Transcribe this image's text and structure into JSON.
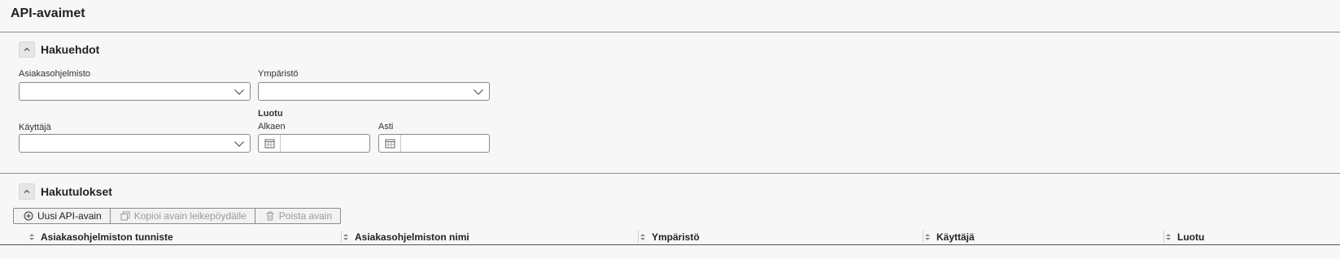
{
  "page": {
    "title": "API-avaimet"
  },
  "search": {
    "title": "Hakuehdot",
    "client_label": "Asiakasohjelmisto",
    "client_value": "",
    "env_label": "Ympäristö",
    "env_value": "",
    "user_label": "Käyttäjä",
    "user_value": "",
    "created_label": "Luotu",
    "from_label": "Alkaen",
    "from_value": "",
    "to_label": "Asti",
    "to_value": ""
  },
  "results": {
    "title": "Hakutulokset",
    "toolbar": {
      "new_label": "Uusi API-avain",
      "copy_label": "Kopioi avain leikepöydälle",
      "delete_label": "Poista avain"
    },
    "columns": [
      "Asiakasohjelmiston tunniste",
      "Asiakasohjelmiston nimi",
      "Ympäristö",
      "Käyttäjä",
      "Luotu"
    ]
  }
}
